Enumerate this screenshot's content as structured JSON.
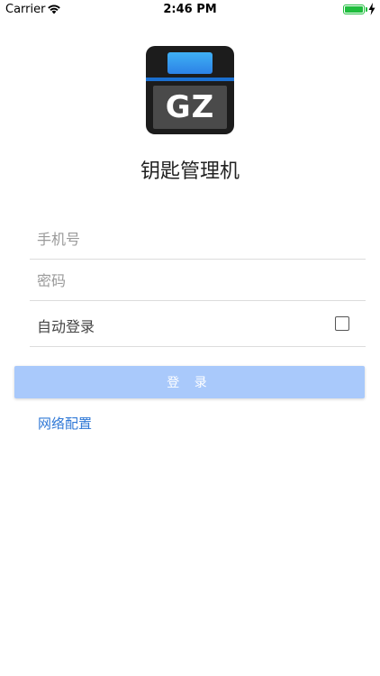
{
  "status_bar": {
    "carrier": "Carrier",
    "time": "2:46 PM"
  },
  "app": {
    "logo_text": "GZ",
    "title": "钥匙管理机"
  },
  "login_form": {
    "phone_placeholder": "手机号",
    "password_placeholder": "密码",
    "auto_login_label": "自动登录",
    "auto_login_checked": false,
    "login_button_label": "登 录",
    "network_config_link": "网络配置"
  },
  "colors": {
    "login_button": "#a9c9fb",
    "link": "#2f78d6",
    "battery": "#1fbd3d",
    "logo_screen": "#3fa2f0"
  },
  "icons": [
    "wifi-icon",
    "battery-icon",
    "charging-bolt-icon",
    "checkbox-icon"
  ]
}
